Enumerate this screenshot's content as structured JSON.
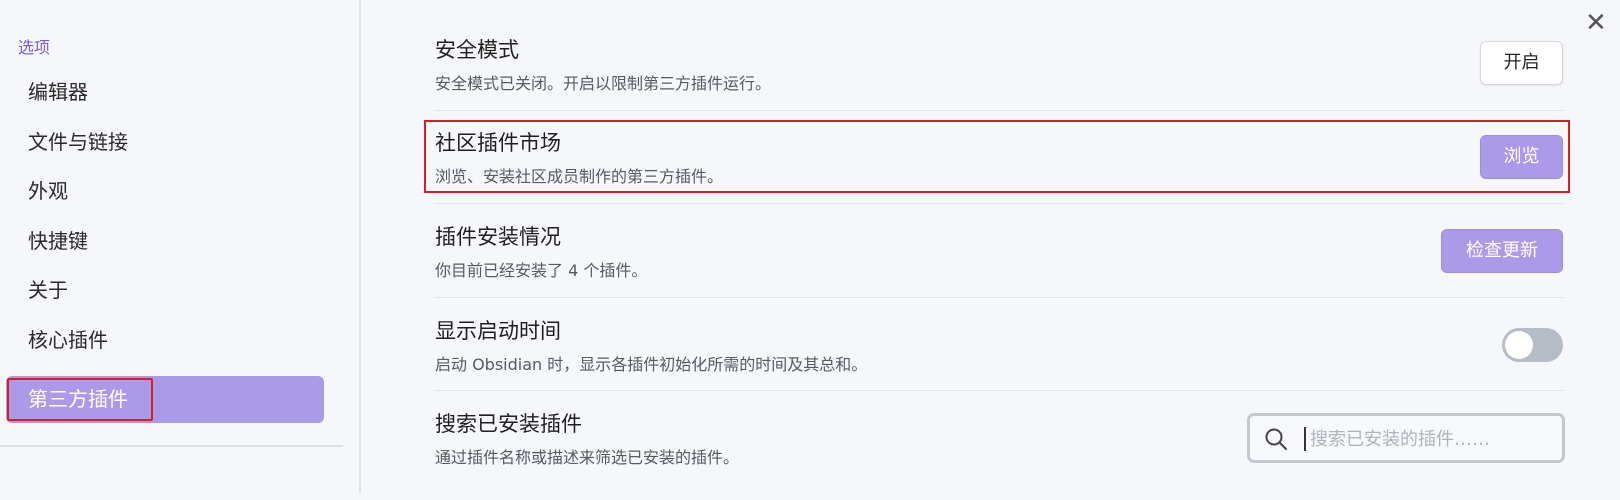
{
  "sidebar": {
    "section_label": "选项",
    "items": [
      {
        "label": "编辑器"
      },
      {
        "label": "文件与链接"
      },
      {
        "label": "外观"
      },
      {
        "label": "快捷键"
      },
      {
        "label": "关于"
      },
      {
        "label": "核心插件"
      },
      {
        "label": "第三方插件",
        "active": true
      }
    ]
  },
  "header": {
    "close_icon": "close-icon"
  },
  "settings": {
    "safe_mode": {
      "title": "安全模式",
      "desc": "安全模式已关闭。开启以限制第三方插件运行。",
      "button": "开启"
    },
    "community": {
      "title": "社区插件市场",
      "desc": "浏览、安装社区成员制作的第三方插件。",
      "button": "浏览"
    },
    "installed": {
      "title": "插件安装情况",
      "desc": "你目前已经安装了 4 个插件。",
      "button": "检查更新"
    },
    "startup_time": {
      "title": "显示启动时间",
      "desc": "启动 Obsidian 时，显示各插件初始化所需的时间及其总和。",
      "enabled": false
    },
    "search": {
      "title": "搜索已安装插件",
      "desc": "通过插件名称或描述来筛选已安装的插件。",
      "placeholder": "搜索已安装的插件……",
      "value": "",
      "icon": "search-icon"
    }
  },
  "colors": {
    "accent": "#ab9ae8",
    "highlight_border": "#d81e28",
    "section_label": "#7e5bd6"
  }
}
